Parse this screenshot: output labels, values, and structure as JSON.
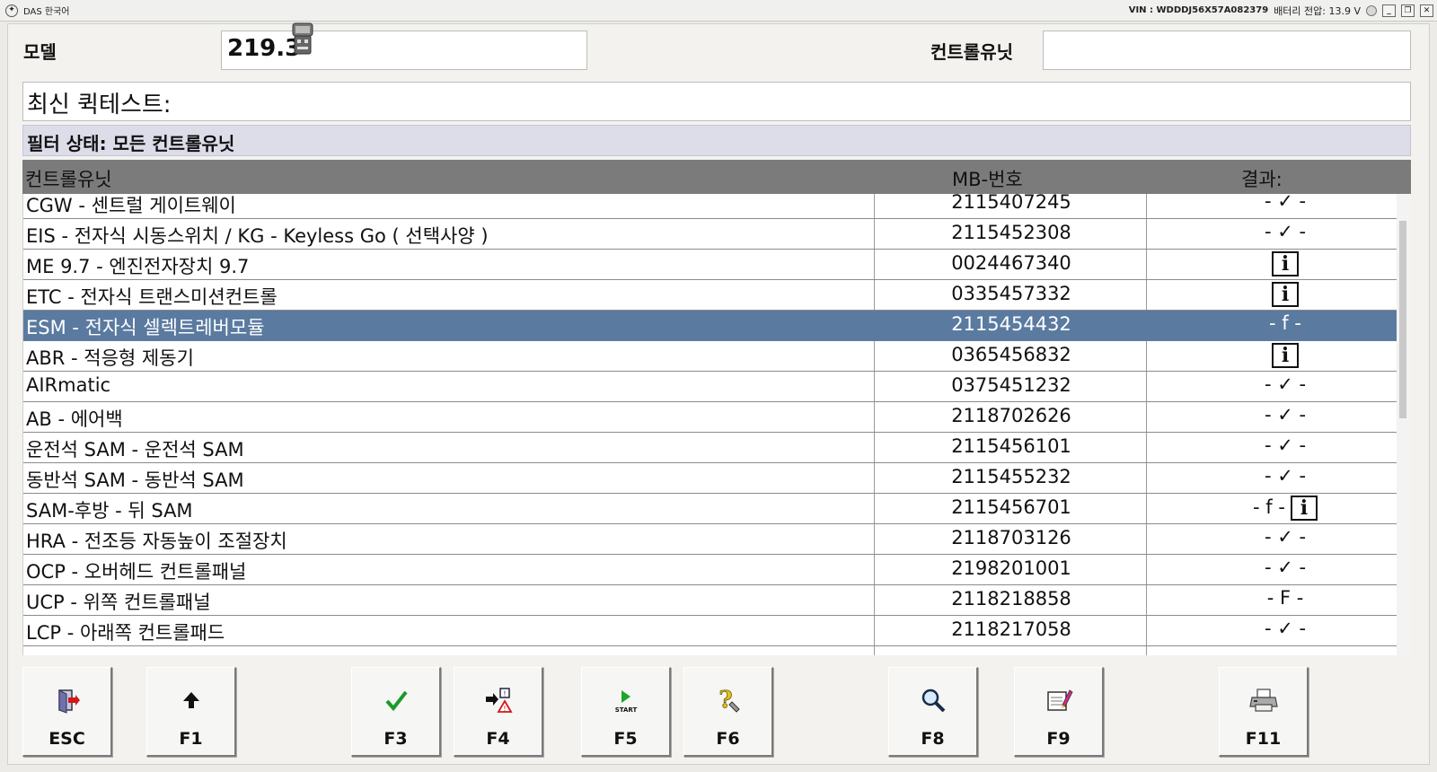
{
  "window": {
    "title": "DAS 한국어",
    "vin": "VIN : WDDDJ56X57A082379",
    "battery": "배터리 전압: 13.9 V"
  },
  "model": {
    "label": "모델",
    "value": "219.3"
  },
  "controlUnit": {
    "label": "컨트롤유닛",
    "value": ""
  },
  "latestRequest": "최신 퀵테스트:",
  "filterStatus": "필터 상태: 모든 컨트롤유닛",
  "table": {
    "headers": {
      "name": "컨트롤유닛",
      "mb": "MB-번호",
      "result": "결과:"
    },
    "rows": [
      {
        "name": "CGW - 센트럴 게이트웨이",
        "mb": "2115407245",
        "result": "- ✓ -",
        "info": false
      },
      {
        "name": "EIS - 전자식 시동스위치 / KG - Keyless Go ( 선택사양 )",
        "mb": "2115452308",
        "result": "- ✓ -",
        "info": false
      },
      {
        "name": "ME 9.7 - 엔진전자장치 9.7",
        "mb": "0024467340",
        "result": "",
        "info": true
      },
      {
        "name": "ETC - 전자식 트랜스미션컨트롤",
        "mb": "0335457332",
        "result": "",
        "info": true
      },
      {
        "name": "ESM - 전자식 셀렉트레버모듈",
        "mb": "2115454432",
        "result": "- f -",
        "info": false,
        "selected": true
      },
      {
        "name": "ABR - 적응형 제동기",
        "mb": "0365456832",
        "result": "",
        "info": true
      },
      {
        "name": "AIRmatic",
        "mb": "0375451232",
        "result": "- ✓ -",
        "info": false
      },
      {
        "name": "AB - 에어백",
        "mb": "2118702626",
        "result": "- ✓ -",
        "info": false
      },
      {
        "name": "운전석 SAM - 운전석 SAM",
        "mb": "2115456101",
        "result": "- ✓ -",
        "info": false
      },
      {
        "name": "동반석 SAM - 동반석 SAM",
        "mb": "2115455232",
        "result": "- ✓ -",
        "info": false
      },
      {
        "name": "SAM-후방 - 뒤 SAM",
        "mb": "2115456701",
        "result": "- f -",
        "info": true
      },
      {
        "name": "HRA - 전조등 자동높이 조절장치",
        "mb": "2118703126",
        "result": "- ✓ -",
        "info": false
      },
      {
        "name": "OCP - 오버헤드 컨트롤패널",
        "mb": "2198201001",
        "result": "- ✓ -",
        "info": false
      },
      {
        "name": "UCP - 위쪽 컨트롤패널",
        "mb": "2118218858",
        "result": "- F -",
        "info": false
      },
      {
        "name": "LCP - 아래쪽 컨트롤패드",
        "mb": "2118217058",
        "result": "- ✓ -",
        "info": false
      }
    ]
  },
  "fkeys": [
    {
      "label": "ESC",
      "icon": "exit-door-icon"
    },
    {
      "label": "F1",
      "icon": "arrow-up-icon"
    },
    {
      "label": "F3",
      "icon": "checkmark-icon"
    },
    {
      "label": "F4",
      "icon": "fault-warning-icon"
    },
    {
      "label": "F5",
      "icon": "start-play-icon"
    },
    {
      "label": "F6",
      "icon": "help-question-icon"
    },
    {
      "label": "F8",
      "icon": "magnifier-icon"
    },
    {
      "label": "F9",
      "icon": "notepad-pen-icon"
    },
    {
      "label": "F11",
      "icon": "printer-icon"
    }
  ],
  "icons": {
    "info": "i",
    "startText": "START"
  },
  "colors": {
    "selectedRow": "#5a7aa0",
    "headerBg": "#7b7b7b",
    "filterBg": "#dcdde9"
  }
}
